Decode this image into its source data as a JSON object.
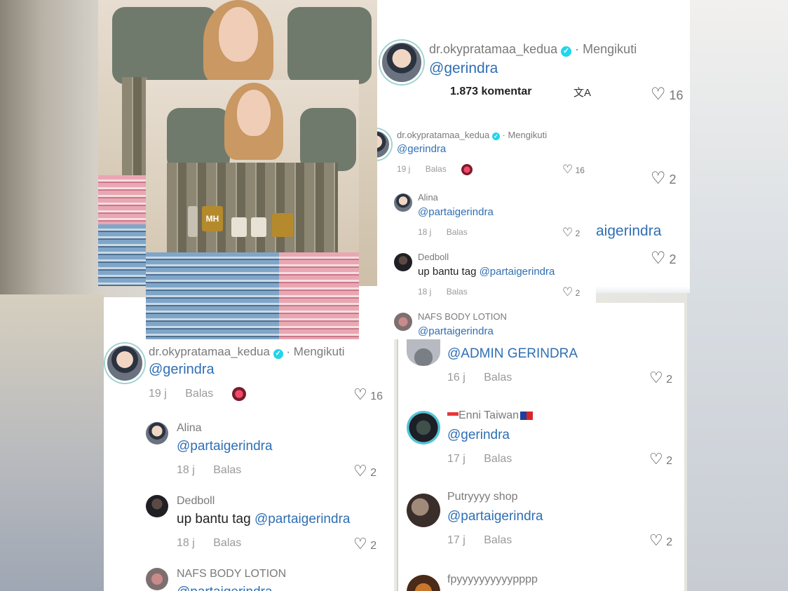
{
  "top_card": {
    "username": "dr.okypratamaa_kedua",
    "follow_status": "· Mengikuti",
    "mention": "@gerindra",
    "comment_count": "1.873 komentar",
    "translate_icon": "文A",
    "likes": "16",
    "side_likes": [
      "2",
      "2"
    ],
    "partial_mention": "aigerindra",
    "edge_mark": "↗"
  },
  "mid_card": {
    "comment": {
      "username": "dr.okypratamaa_kedua",
      "follow_status": "· Mengikuti",
      "mention": "@gerindra",
      "time": "19 j",
      "reply": "Balas",
      "likes": "16"
    },
    "replies": [
      {
        "username": "Alina",
        "text": "@partaigerindra",
        "time": "18 j",
        "reply": "Balas",
        "likes": "2"
      },
      {
        "username": "Dedboll",
        "prefix": "up bantu tag ",
        "text": "@partaigerindra",
        "time": "18 j",
        "reply": "Balas",
        "likes": "2"
      },
      {
        "username": "NAFS BODY LOTION",
        "text": "@partaigerindra"
      }
    ]
  },
  "bottom_left": {
    "comment": {
      "username": "dr.okypratamaa_kedua",
      "follow_status": "· Mengikuti",
      "mention": "@gerindra",
      "time": "19 j",
      "reply": "Balas",
      "likes": "16"
    },
    "replies": [
      {
        "username": "Alina",
        "text": "@partaigerindra",
        "time": "18 j",
        "reply": "Balas",
        "likes": "2"
      },
      {
        "username": "Dedboll",
        "prefix": "up bantu tag ",
        "text": "@partaigerindra",
        "time": "18 j",
        "reply": "Balas",
        "likes": "2"
      },
      {
        "username": "NAFS BODY LOTION",
        "text": "@partaigerindra"
      }
    ]
  },
  "bottom_right": {
    "items": [
      {
        "username": "",
        "text": "@ADMIN GERINDRA",
        "time": "16 j",
        "reply": "Balas",
        "likes": "2"
      },
      {
        "username": "Enni Taiwan",
        "text": "@gerindra",
        "time": "17 j",
        "reply": "Balas",
        "likes": "2"
      },
      {
        "username": "Putryyyy shop",
        "text": "@partaigerindra",
        "time": "17 j",
        "reply": "Balas",
        "likes": "2"
      },
      {
        "username": "fpyyyyyyyyyypppp",
        "text": ""
      }
    ]
  },
  "photo": {
    "brand_badge": "MH"
  },
  "colors": {
    "mention_blue": "#2f6fb3",
    "verified": "#20d5ec",
    "meta_grey": "#9a9a9a"
  }
}
